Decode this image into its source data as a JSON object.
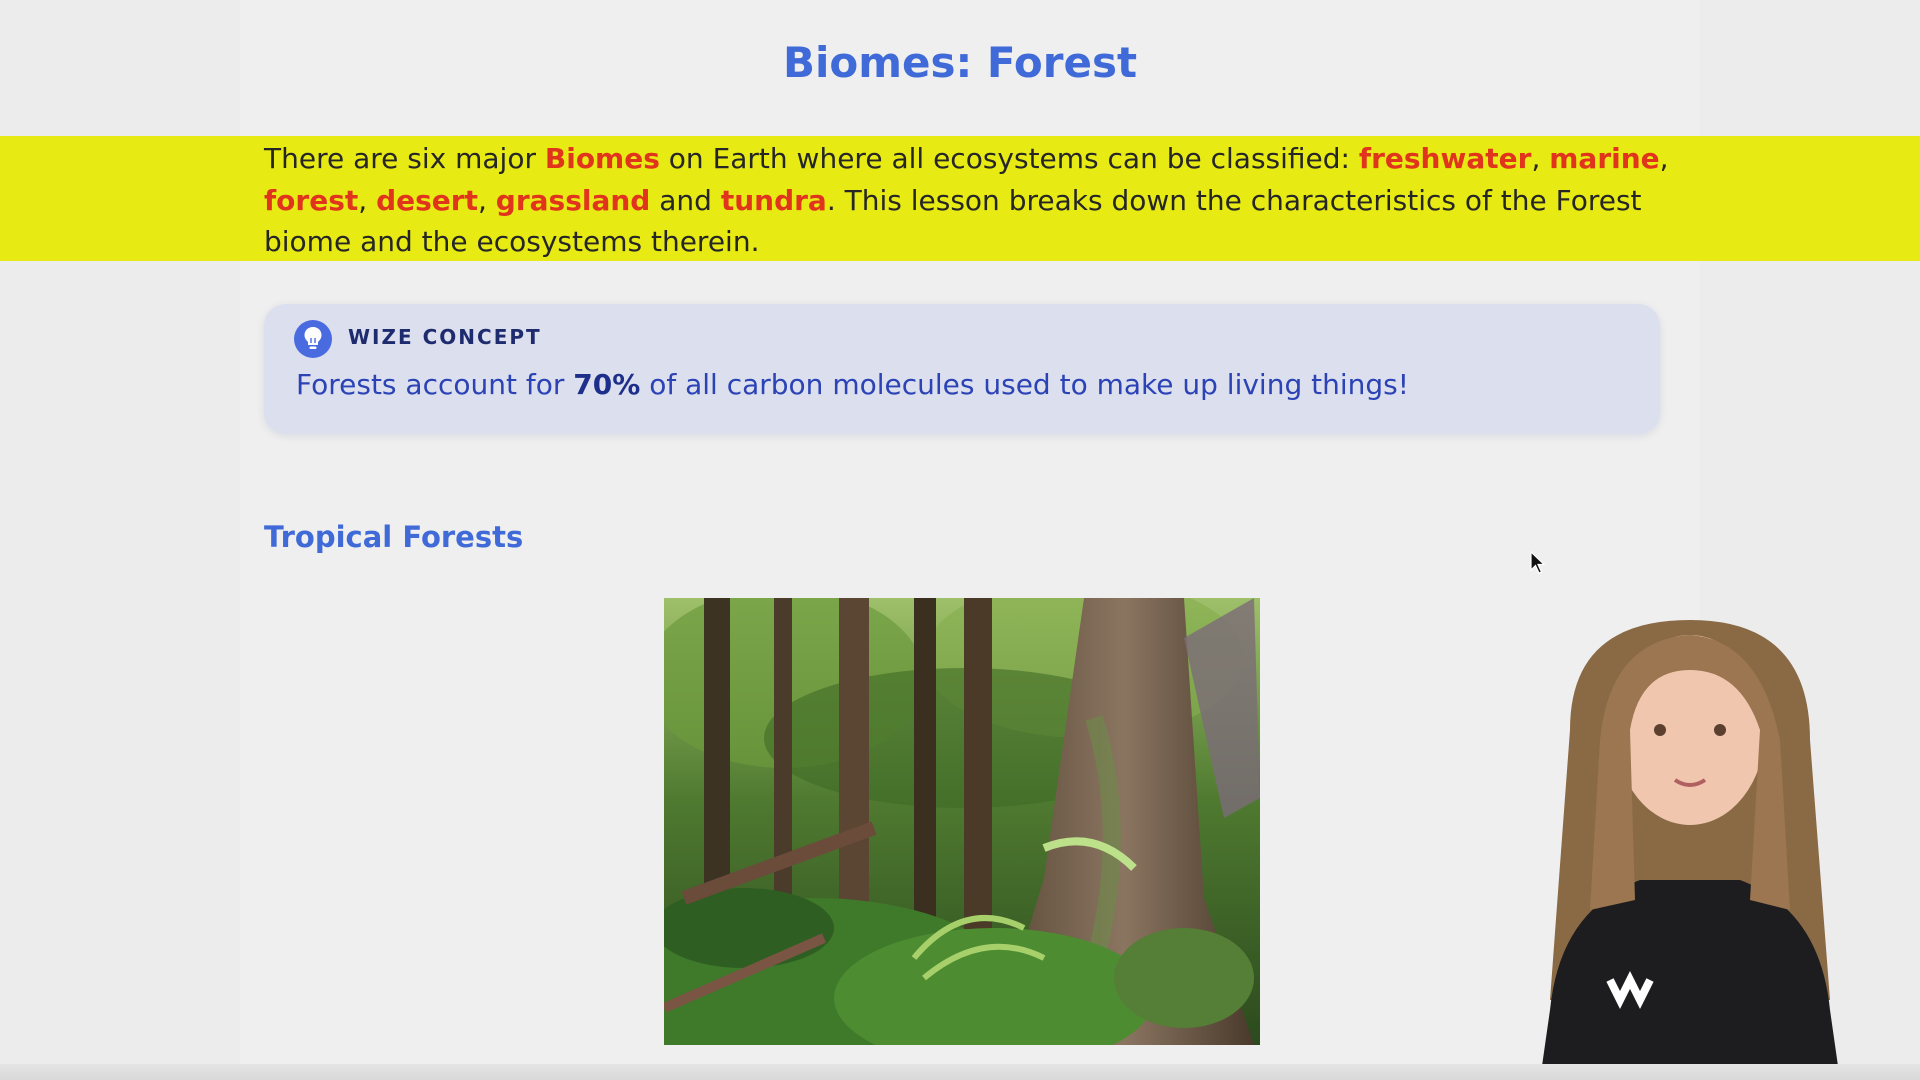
{
  "lesson": {
    "title": "Biomes: Forest",
    "intro": {
      "t1": "There are six major ",
      "k1": "Biomes",
      "t2": " on Earth where all ecosystems can be classified: ",
      "k2": "freshwater",
      "t3": ", ",
      "k3": "marine",
      "t4": ", ",
      "k4": "forest",
      "t5": ", ",
      "k5": "desert",
      "t6": ", ",
      "k6": "grassland",
      "t7": " and ",
      "k7": "tundra",
      "t8": ". This lesson breaks down the characteristics of the Forest biome and the ecosystems therein."
    },
    "callout": {
      "icon": "lightbulb-icon",
      "label": "WIZE CONCEPT",
      "t1": "Forests account for ",
      "bold": "70%",
      "t2": " of all carbon molecules used to make up living things!"
    },
    "section_title": "Tropical Forests"
  },
  "colors": {
    "accent": "#3f6ad8",
    "highlight": "#e8ea14",
    "keyword": "#e0341d",
    "callout_bg": "#dcdfee",
    "callout_text": "#2b43b5"
  }
}
